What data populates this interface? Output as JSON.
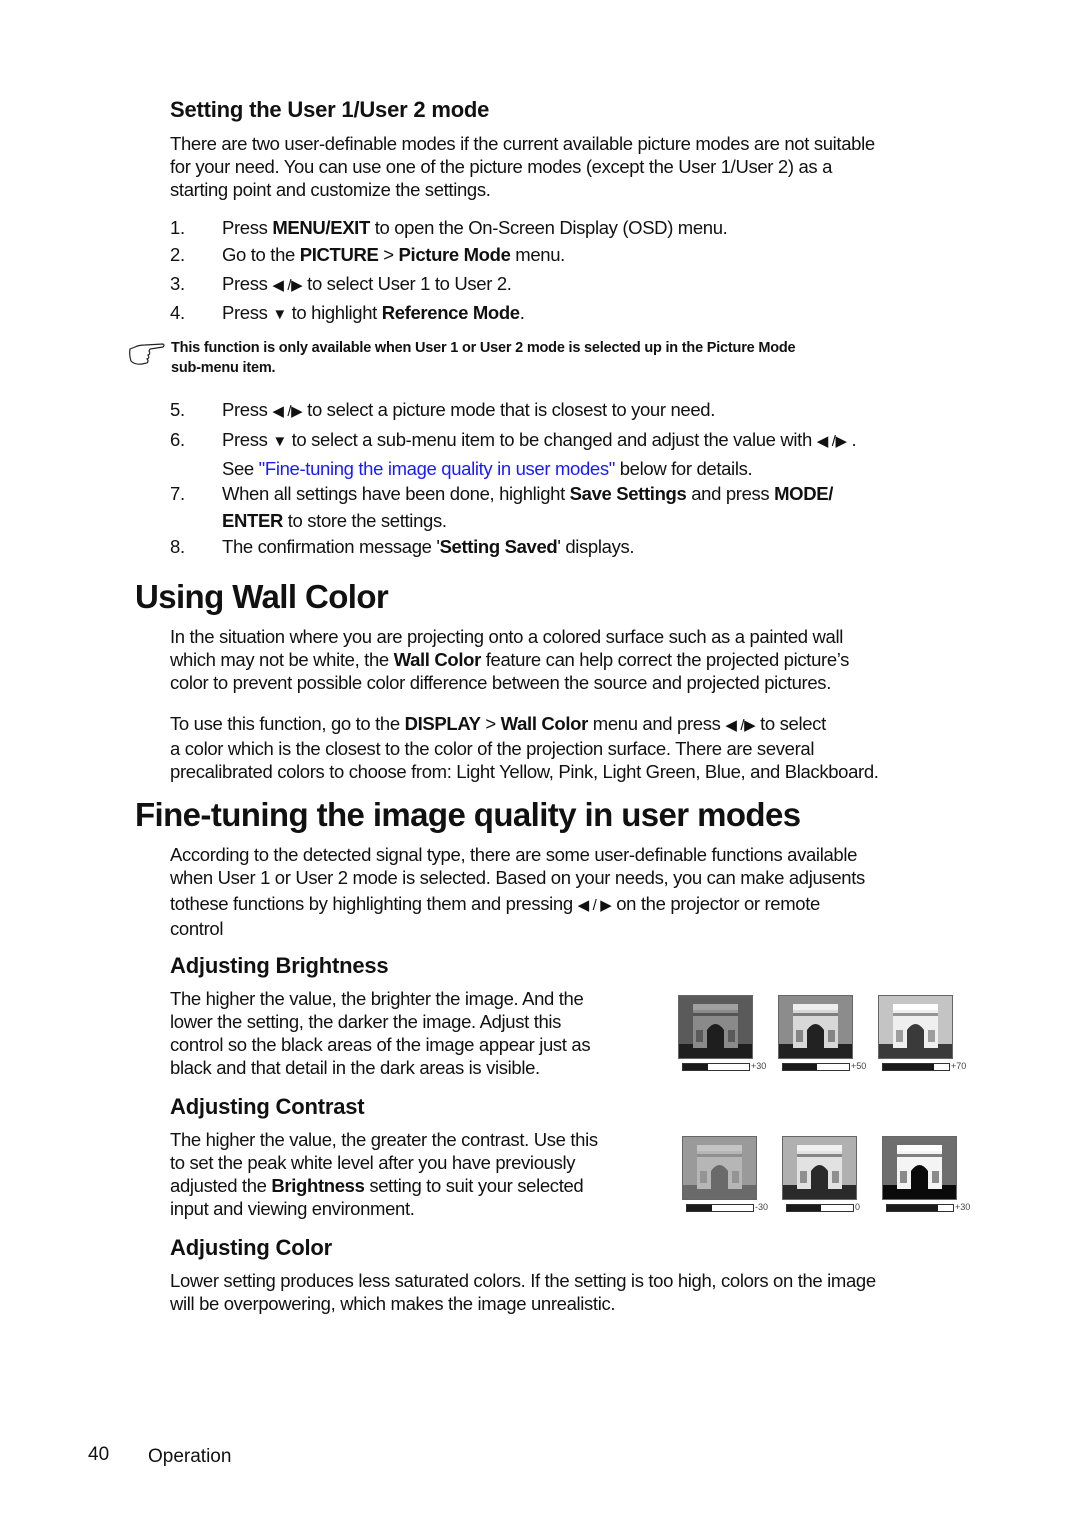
{
  "section_user_mode": {
    "heading": "Setting the User 1/User 2 mode",
    "intro": [
      "There are two user-definable modes if the current available picture modes are not suitable",
      "for your need. You can use one of the picture modes (except the User 1/User 2) as a",
      "starting point and customize the settings."
    ],
    "steps_a": [
      {
        "num": "1.",
        "pre": "Press ",
        "b1": "MENU/EXIT",
        "post": " to open the On-Screen Display (OSD) menu."
      },
      {
        "num": "2.",
        "pre": "Go to the ",
        "b1": "PICTURE",
        "mid": " > ",
        "b2": "Picture Mode",
        "post": " menu."
      },
      {
        "num": "3.",
        "pre": "Press ",
        "arrows": "◀ /▶",
        "post": "  to select User 1 to User 2."
      },
      {
        "num": "4.",
        "pre": "Press ",
        "arrows": "▼",
        "post": "  to highlight ",
        "b1": "Reference Mode",
        "end": "."
      }
    ],
    "note": {
      "icon": "pointing-hand-icon",
      "line1": "This function is only available when User 1 or User 2 mode is selected up in the Picture Mode",
      "line2": "sub-menu item."
    },
    "steps_b": [
      {
        "num": "5.",
        "pre": "Press ",
        "arrows": "◀ /▶",
        "post": "  to select a picture mode that is closest to your need."
      },
      {
        "num": "6.",
        "pre": "Press ",
        "arrows": "▼",
        "post": "  to select a sub-menu item to be changed and adjust the value with ",
        "arrows2": "◀ /▶",
        "end": " .",
        "line2_pre": "See ",
        "link": "\"Fine-tuning the image quality in user modes\"",
        "line2_post": " below for details."
      },
      {
        "num": "7.",
        "pre": "When all settings have been done, highlight ",
        "b1": "Save Settings",
        "mid": " and press ",
        "b2": "MODE/",
        "line2_b": "ENTER",
        "line2_post": " to store the settings."
      },
      {
        "num": "8.",
        "pre": "The confirmation message '",
        "b1": "Setting Saved",
        "post": "' displays."
      }
    ]
  },
  "section_wall_color": {
    "heading": "Using Wall Color",
    "para1": {
      "l1": "In the situation where you are projecting onto a colored surface such as a painted wall",
      "l2_pre": "which may not be white, the ",
      "l2_b": "Wall Color",
      "l2_post": " feature can help correct the projected picture’s",
      "l3": "color to prevent possible color difference between the source and projected pictures."
    },
    "para2": {
      "l1_pre": "To use this function, go to the ",
      "l1_b1": "DISPLAY",
      "l1_mid": " > ",
      "l1_b2": "Wall Color",
      "l1_post": " menu and press ",
      "l1_arrows": "◀ /▶",
      "l1_end": "  to select",
      "l2": "a color which is the closest to the color of the projection surface. There are several",
      "l3": "precalibrated colors to choose from: Light Yellow, Pink, Light Green, Blue, and Blackboard."
    }
  },
  "section_fine_tuning": {
    "heading": "Fine-tuning the image quality in user modes",
    "intro": {
      "l1": "According to the detected signal type, there are some user-definable functions available",
      "l2": "when User 1 or User 2 mode is selected. Based on your needs, you can make adjusents",
      "l3_pre": "tothese functions by highlighting them and pressing ",
      "l3_arrows": "◀ / ▶",
      "l3_post": " on the projector or remote",
      "l4": "control"
    },
    "brightness": {
      "heading": "Adjusting Brightness",
      "lines": [
        "The higher the value, the brighter the image. And the",
        "lower the setting, the darker the image. Adjust this",
        "control so the black areas of the image appear just as",
        "black and that detail in the dark areas is visible."
      ],
      "samples": [
        {
          "label": "+30",
          "fill": 0.38
        },
        {
          "label": "+50",
          "fill": 0.52
        },
        {
          "label": "+70",
          "fill": 0.78
        }
      ]
    },
    "contrast": {
      "heading": "Adjusting Contrast",
      "lines": [
        "The higher the value, the greater the contrast. Use this",
        "to set the peak white level after you have previously"
      ],
      "line3_pre": "adjusted the ",
      "line3_b": "Brightness",
      "line3_post": " setting to suit your selected",
      "line4": "input and viewing environment.",
      "samples": [
        {
          "label": "-30",
          "fill": 0.38
        },
        {
          "label": "0",
          "fill": 0.52
        },
        {
          "label": "+30",
          "fill": 0.78
        }
      ]
    },
    "color": {
      "heading": "Adjusting Color",
      "lines": [
        "Lower setting produces less saturated colors. If the setting is too high, colors on the image",
        "will be overpowering, which makes the image unrealistic."
      ]
    }
  },
  "footer": {
    "page_number": "40",
    "section": "Operation"
  }
}
